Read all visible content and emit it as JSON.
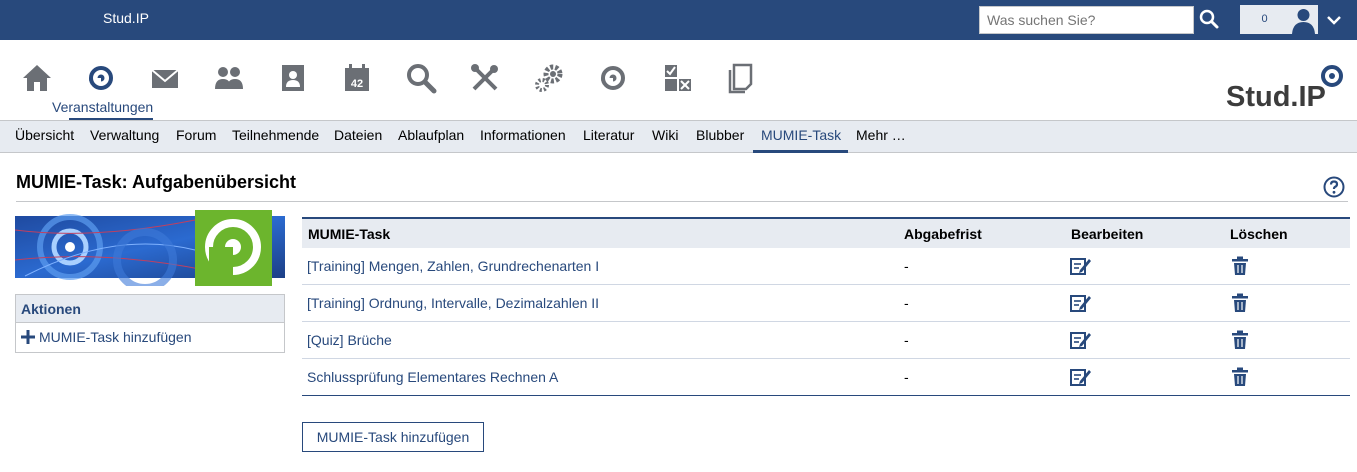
{
  "topbar": {
    "brand": "Stud.IP",
    "search_placeholder": "Was suchen Sie?",
    "notification_count": "0"
  },
  "nav": {
    "icons": [
      "home-icon",
      "courses-icon",
      "mail-icon",
      "community-icon",
      "profile-icon",
      "calendar-icon",
      "search-icon",
      "tools-icon",
      "admin-icon",
      "resources-icon",
      "evaluation-icon",
      "files-icon"
    ],
    "active_label": "Veranstaltungen",
    "calendar_day": "42"
  },
  "tabs": [
    {
      "label": "Übersicht"
    },
    {
      "label": "Verwaltung"
    },
    {
      "label": "Forum"
    },
    {
      "label": "Teilnehmende"
    },
    {
      "label": "Dateien"
    },
    {
      "label": "Ablaufplan"
    },
    {
      "label": "Informationen"
    },
    {
      "label": "Literatur"
    },
    {
      "label": "Wiki"
    },
    {
      "label": "Blubber"
    },
    {
      "label": "MUMIE-Task",
      "active": true
    },
    {
      "label": "Mehr …"
    }
  ],
  "page": {
    "title": "MUMIE-Task: Aufgabenübersicht"
  },
  "sidebar": {
    "actions_title": "Aktionen",
    "actions": [
      {
        "label": "MUMIE-Task hinzufügen"
      }
    ]
  },
  "table": {
    "headers": [
      "MUMIE-Task",
      "Abgabefrist",
      "Bearbeiten",
      "Löschen"
    ],
    "rows": [
      {
        "task": "[Training] Mengen, Zahlen, Grundrechenarten I",
        "deadline": "-"
      },
      {
        "task": "[Training] Ordnung, Intervalle, Dezimalzahlen II",
        "deadline": "-"
      },
      {
        "task": "[Quiz] Brüche",
        "deadline": "-"
      },
      {
        "task": "Schlussprüfung Elementares Rechnen A",
        "deadline": "-"
      }
    ]
  },
  "add_button": "MUMIE-Task hinzufügen",
  "colors": {
    "brand_blue": "#28497c",
    "light_blue": "#e7ebf1",
    "icon_gray": "#6b6f75",
    "mumie_green": "#6cb52d"
  }
}
